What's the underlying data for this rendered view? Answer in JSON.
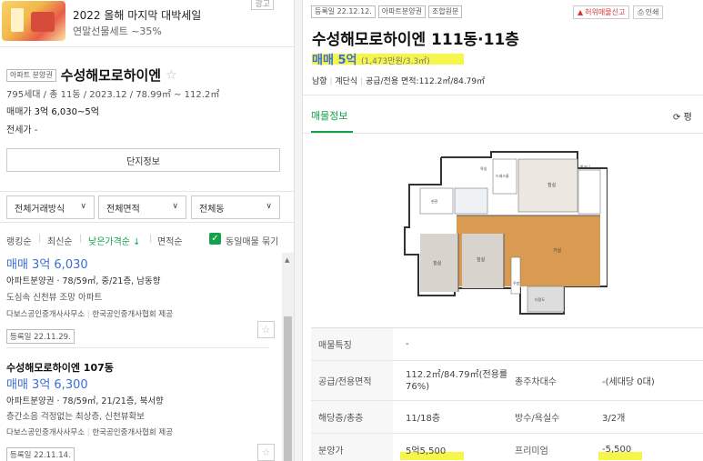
{
  "ad": {
    "title": "2022 올해 마지막 대박세일",
    "subtitle": "연말선물세트 ~35%",
    "close": "광고"
  },
  "complex": {
    "tag": "아파트 분양권",
    "name": "수성해모로하이엔",
    "info": "795세대 / 총 11동 / 2023.12 / 78.99㎡ ~ 112.2㎡",
    "sale_label": "매매가",
    "sale_value": "3억 6,030~5억",
    "jeonse_label": "전세가",
    "jeonse_value": "-",
    "danji_button": "단지정보"
  },
  "filters": [
    "전체거래방식",
    "전체면적",
    "전체동"
  ],
  "sort": {
    "options": [
      "랭킹순",
      "최신순",
      "낮은가격순 ↓",
      "면적순"
    ],
    "same_listing": "동일매물 묶기"
  },
  "listings": [
    {
      "title": "",
      "price": "매매 3억 6,030",
      "details": "아파트분양권 · 78/59㎡, 중/21층, 남동향",
      "desc": "도심속 신천뷰 조망 아파트",
      "agent": "다보스공인중개사사무소",
      "source": "한국공인중개사협회 제공",
      "date": "등록일 22.11.29."
    },
    {
      "title": "수성해모로하이엔 107동",
      "price": "매매 3억 6,300",
      "details": "아파트분양권 · 78/59㎡, 21/21층, 북서향",
      "desc": "층간소음 걱정없는 최상층, 신천뷰확보",
      "agent": "다보스공인중개사사무소",
      "source": "한국공인중개사협회 제공",
      "date": "등록일 22.11.14."
    }
  ],
  "detail": {
    "tags": [
      "등록일 22.12.12.",
      "아파트분양권",
      "조합원분"
    ],
    "report": "허위매물신고",
    "print": "인쇄",
    "title": "수성해모로하이엔 111동·11층",
    "price": "매매 5억",
    "price_unit": "(1,473만원/3.3㎡)",
    "meta": [
      "남향",
      "계단식",
      "공급/전용 면적:112.2㎡/84.79㎡"
    ],
    "tab": "매물정보",
    "refresh": "평",
    "plan_rooms": {
      "bath1": "욕실",
      "dress": "드레스룸",
      "room_big": "침실",
      "balcony": "발코니",
      "entrance": "현관",
      "living": "거실",
      "kitchen": "주방",
      "room2": "침실",
      "room3": "침실",
      "util": "다용도"
    },
    "rows": [
      {
        "label": "매물특징",
        "value": "-",
        "label2": "",
        "value2": ""
      },
      {
        "label": "공급/전용면적",
        "value": "112.2㎡/84.79㎡(전용률76%)",
        "label2": "총주차대수",
        "value2": "-(세대당 0대)"
      },
      {
        "label": "해당층/총층",
        "value": "11/18층",
        "label2": "방수/욕실수",
        "value2": "3/2개"
      },
      {
        "label": "분양가",
        "value": "5억5,500",
        "label2": "프리미엄",
        "value2": "-5,500"
      }
    ]
  },
  "colors": {
    "accent_green": "#14a24d",
    "price_blue": "#3a6ed8",
    "highlight_yellow": "#f6f64a"
  }
}
